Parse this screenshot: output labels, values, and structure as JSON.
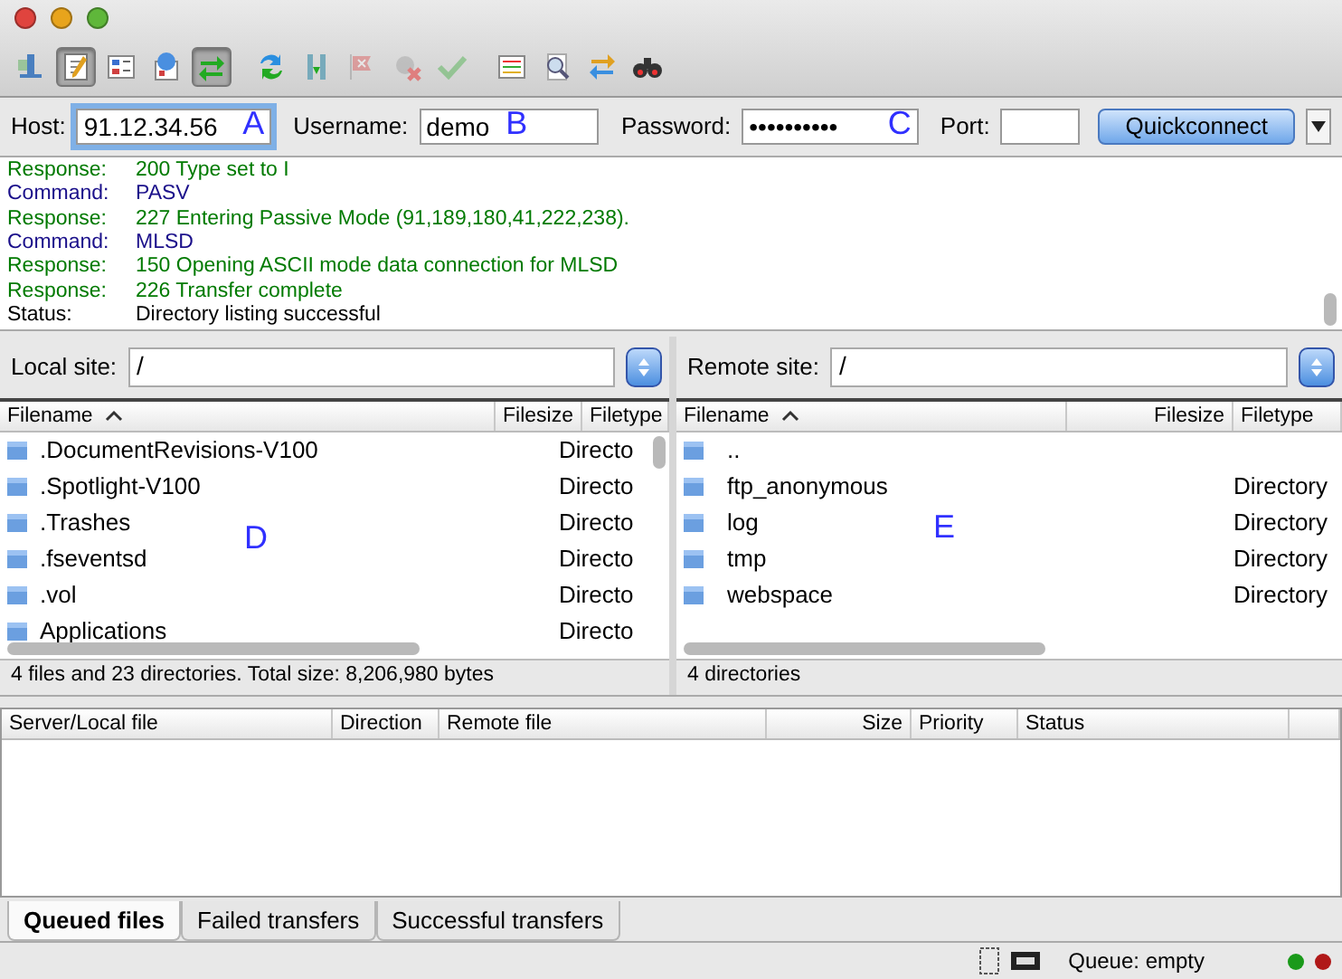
{
  "toolbar": [
    {
      "pressed": false,
      "disabled": false
    },
    {
      "pressed": true,
      "disabled": false
    },
    {
      "pressed": false,
      "disabled": false
    },
    {
      "pressed": false,
      "disabled": false
    },
    {
      "pressed": true,
      "disabled": false
    },
    {
      "pressed": false,
      "disabled": false
    },
    {
      "pressed": false,
      "disabled": false
    },
    {
      "pressed": false,
      "disabled": true
    },
    {
      "pressed": false,
      "disabled": true
    },
    {
      "pressed": false,
      "disabled": true
    },
    {
      "pressed": false,
      "disabled": false
    },
    {
      "pressed": false,
      "disabled": false
    },
    {
      "pressed": false,
      "disabled": false
    },
    {
      "pressed": false,
      "disabled": false
    }
  ],
  "quickconnect": {
    "host": {
      "label": "Host:",
      "value": "91.12.34.56",
      "annotation": "A",
      "focused": true
    },
    "username": {
      "label": "Username:",
      "value": "demo",
      "annotation": "B"
    },
    "password": {
      "label": "Password:",
      "value": "••••••••••",
      "annotation": "C"
    },
    "port": {
      "label": "Port:"
    },
    "button": "Quickconnect"
  },
  "log": [
    {
      "kind": "response",
      "label": "Response:",
      "text": "200 Type set to I"
    },
    {
      "kind": "command",
      "label": "Command:",
      "text": "PASV"
    },
    {
      "kind": "response",
      "label": "Response:",
      "text": "227 Entering Passive Mode (91,189,180,41,222,238)."
    },
    {
      "kind": "command",
      "label": "Command:",
      "text": "MLSD"
    },
    {
      "kind": "response",
      "label": "Response:",
      "text": "150 Opening ASCII mode data connection for MLSD"
    },
    {
      "kind": "response",
      "label": "Response:",
      "text": "226 Transfer complete"
    },
    {
      "kind": "status",
      "label": "Status:",
      "text": "Directory listing successful"
    }
  ],
  "local": {
    "label": "Local site:",
    "path": "/",
    "columns": [
      "Filename",
      "Filesize",
      "Filetype"
    ],
    "annotation": "D",
    "rows": [
      {
        "name": ".DocumentRevisions-V100",
        "type": "Directo"
      },
      {
        "name": ".Spotlight-V100",
        "type": "Directo"
      },
      {
        "name": ".Trashes",
        "type": "Directo"
      },
      {
        "name": ".fseventsd",
        "type": "Directo"
      },
      {
        "name": ".vol",
        "type": "Directo"
      },
      {
        "name": "Applications",
        "type": "Directo"
      }
    ],
    "summary": "4 files and 23 directories. Total size: 8,206,980 bytes"
  },
  "remote": {
    "label": "Remote site:",
    "path": "/",
    "columns": [
      "Filename",
      "Filesize",
      "Filetype"
    ],
    "annotation": "E",
    "rows": [
      {
        "name": ".."
      },
      {
        "name": "ftp_anonymous",
        "type": "Directory"
      },
      {
        "name": "log",
        "type": "Directory"
      },
      {
        "name": "tmp",
        "type": "Directory"
      },
      {
        "name": "webspace",
        "type": "Directory"
      }
    ],
    "summary": "4 directories"
  },
  "queue": {
    "columns": [
      "Server/Local file",
      "Direction",
      "Remote file",
      "Size",
      "Priority",
      "Status"
    ]
  },
  "tabs": [
    {
      "label": "Queued files",
      "selected": true
    },
    {
      "label": "Failed transfers",
      "selected": false
    },
    {
      "label": "Successful transfers",
      "selected": false
    }
  ],
  "status_bar": {
    "queue": "Queue: empty"
  }
}
